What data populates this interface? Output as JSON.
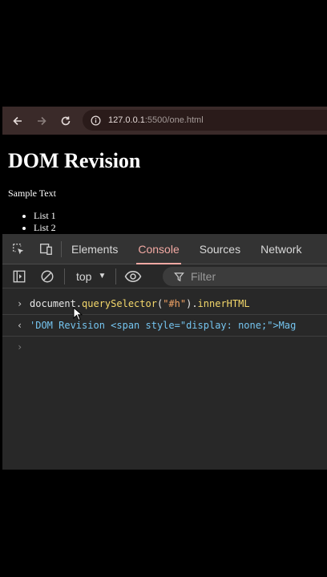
{
  "browser": {
    "url_host": "127.0.0.1",
    "url_rest": ":5500/one.html",
    "icons": {
      "back": "arrow-left-icon",
      "forward": "arrow-right-icon",
      "reload": "reload-icon",
      "info": "info-icon"
    }
  },
  "page": {
    "heading": "DOM Revision",
    "sample": "Sample Text",
    "list": [
      "List 1",
      "List 2"
    ]
  },
  "devtools": {
    "tabs": [
      "Elements",
      "Console",
      "Sources",
      "Network"
    ],
    "active_tab": "Console",
    "context": "top",
    "filter_placeholder": "Filter",
    "accent": "#f2a9a3",
    "console": {
      "input_obj": "document",
      "input_dot": ".",
      "input_method": "querySelector",
      "input_open": "(",
      "input_arg": "\"#h\"",
      "input_close": ").",
      "input_prop": "innerHTML",
      "output": "'DOM Revision <span style=\"display: none;\">Mag"
    }
  }
}
